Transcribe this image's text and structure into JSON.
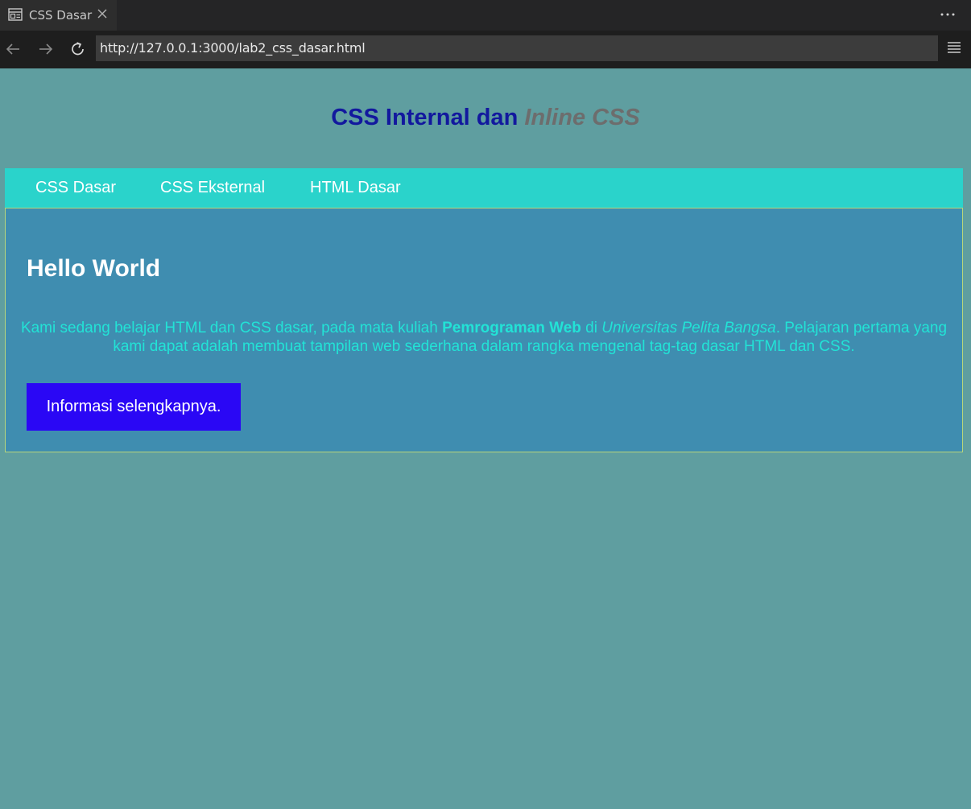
{
  "browser": {
    "tab_title": "CSS Dasar",
    "tab_icon": "page-icon",
    "close_icon": "close-icon",
    "more_icon": "more-icon",
    "url": "http://127.0.0.1:3000/lab2_css_dasar.html",
    "back_icon": "back-arrow-icon",
    "forward_icon": "forward-arrow-icon",
    "reload_icon": "reload-icon",
    "menu_icon": "hamburger-menu-icon"
  },
  "page": {
    "title_main": "CSS Internal dan ",
    "title_italic": "Inline CSS",
    "menu": [
      {
        "label": "CSS Dasar"
      },
      {
        "label": "CSS Eksternal"
      },
      {
        "label": "HTML Dasar"
      }
    ],
    "content": {
      "heading": "Hello World",
      "paragraph": {
        "part1": "Kami sedang belajar HTML dan CSS dasar, pada mata kuliah ",
        "bold": "Pemrograman Web",
        "part2": " di ",
        "italic": "Universitas Pelita Bangsa",
        "part3": ". Pelajaran pertama yang kami dapat adalah membuat tampilan web sederhana dalam rangka mengenal tag-tag dasar HTML dan CSS."
      },
      "button_label": "Informasi selengkapnya."
    }
  },
  "colors": {
    "page_bg": "#5f9ea0",
    "title": "#12189e",
    "title_italic": "#6d6d6d",
    "menu_bg": "#2ad3cb",
    "content_bg": "#3f8db0",
    "paragraph": "#22e3d6",
    "button_bg": "#2a07f5"
  }
}
